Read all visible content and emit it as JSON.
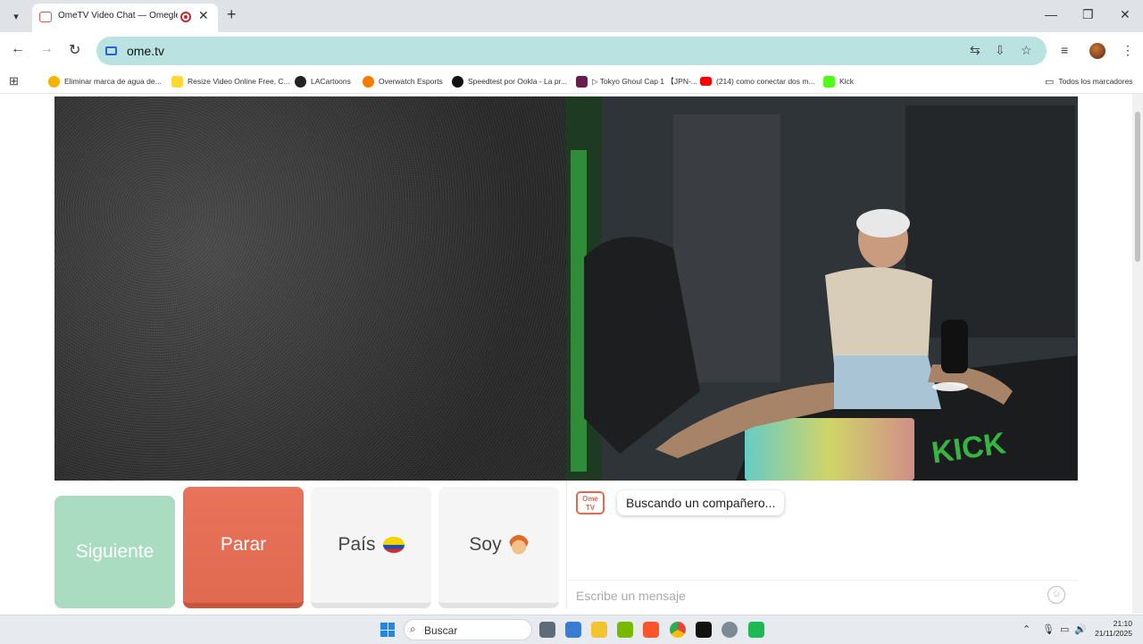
{
  "browser": {
    "tab_title": "OmeTV Video Chat — Omegle Rand",
    "new_tab": "+",
    "tab_close": "✕",
    "url": "ome.tv",
    "window": {
      "minimize": "—",
      "maximize": "❐",
      "close": "✕"
    }
  },
  "bookmarks": [
    {
      "label": "Eliminar marca de agua de...",
      "color": "#f4b400"
    },
    {
      "label": "Resize Video Online Free, C...",
      "color": "#fdd835"
    },
    {
      "label": "LACartoons",
      "color": "#222222"
    },
    {
      "label": "Overwatch Esports",
      "color": "#f57c00"
    },
    {
      "label": "Speedtest por Ookla - La pr...",
      "color": "#111111"
    },
    {
      "label": "▷ Tokyo Ghoul Cap 1 【JPN-...",
      "color": "#6a1b4d"
    },
    {
      "label": "(214) como conectar dos m...",
      "color": "#ff0000"
    },
    {
      "label": "Kick",
      "color": "#53fc18"
    }
  ],
  "all_bookmarks": "Todos los marcadores",
  "ometv": {
    "next_button": "Siguiente",
    "stop_button": "Parar",
    "country_button": "País",
    "gender_button": "Soy",
    "chat_logo": "Ome TV",
    "status_message": "Buscando un compañero...",
    "message_placeholder": "Escribe un mensaje"
  },
  "taskbar": {
    "search_label": "Buscar",
    "time": "21:10",
    "date": "21/11/2025"
  },
  "colors": {
    "accent": "#b9e2e0",
    "next": "#a9dcc0",
    "stop": "#e06a50"
  }
}
